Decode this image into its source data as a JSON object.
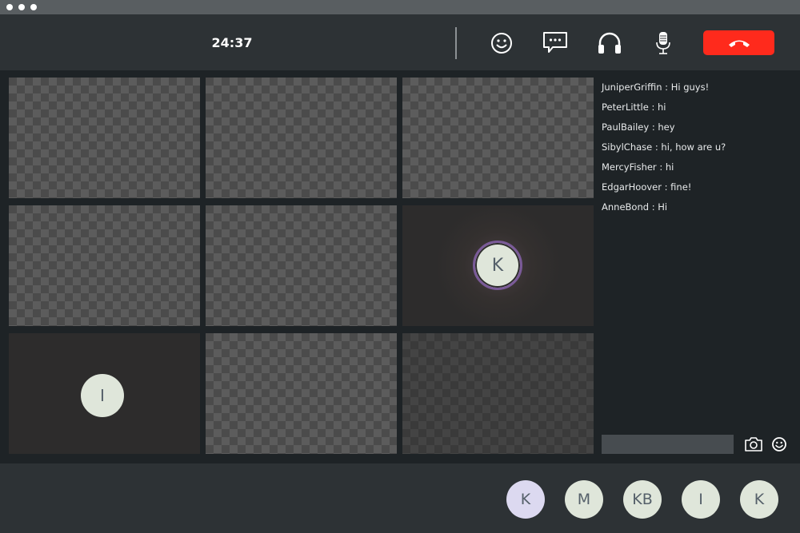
{
  "app": {
    "timer": "24:37",
    "colors": {
      "accent_red": "#ff2a1c",
      "avatar_bg": "#dfe6da",
      "avatar_highlight": "#dcd9f0",
      "ring": "#7a5a98"
    }
  },
  "toolbar": {
    "icons": [
      "smiley-icon",
      "chat-bubble-icon",
      "headphones-icon",
      "microphone-icon",
      "phone-hangup-icon"
    ]
  },
  "grid": {
    "tiles": [
      {
        "id": "t1",
        "type": "empty"
      },
      {
        "id": "t2",
        "type": "empty"
      },
      {
        "id": "t3",
        "type": "empty"
      },
      {
        "id": "t4",
        "type": "empty"
      },
      {
        "id": "t5",
        "type": "empty"
      },
      {
        "id": "t6",
        "type": "avatar",
        "initial": "K",
        "speaking": true
      },
      {
        "id": "t7",
        "type": "avatar",
        "initial": "I"
      },
      {
        "id": "t8",
        "type": "empty"
      },
      {
        "id": "t9",
        "type": "empty"
      }
    ]
  },
  "chat": {
    "messages": [
      {
        "user": "JuniperGriffin",
        "sep": " : ",
        "text": "Hi guys!"
      },
      {
        "user": "PeterLittle",
        "sep": " : ",
        "text": "hi"
      },
      {
        "user": "PaulBailey",
        "sep": " : ",
        "text": "hey"
      },
      {
        "user": "SibylChase",
        "sep": " : ",
        "text": "hi, how are u?"
      },
      {
        "user": "MercyFisher",
        "sep": " : ",
        "text": "hi"
      },
      {
        "user": "EdgarHoover",
        "sep": " : ",
        "text": "fine!"
      },
      {
        "user": "AnneBond",
        "sep": " : ",
        "text": "Hi"
      }
    ],
    "input_value": "",
    "icons": [
      "camera-icon",
      "emoji-icon"
    ]
  },
  "participants": [
    {
      "initials": "K",
      "active": true
    },
    {
      "initials": "M"
    },
    {
      "initials": "KB"
    },
    {
      "initials": "I"
    },
    {
      "initials": "K"
    }
  ]
}
